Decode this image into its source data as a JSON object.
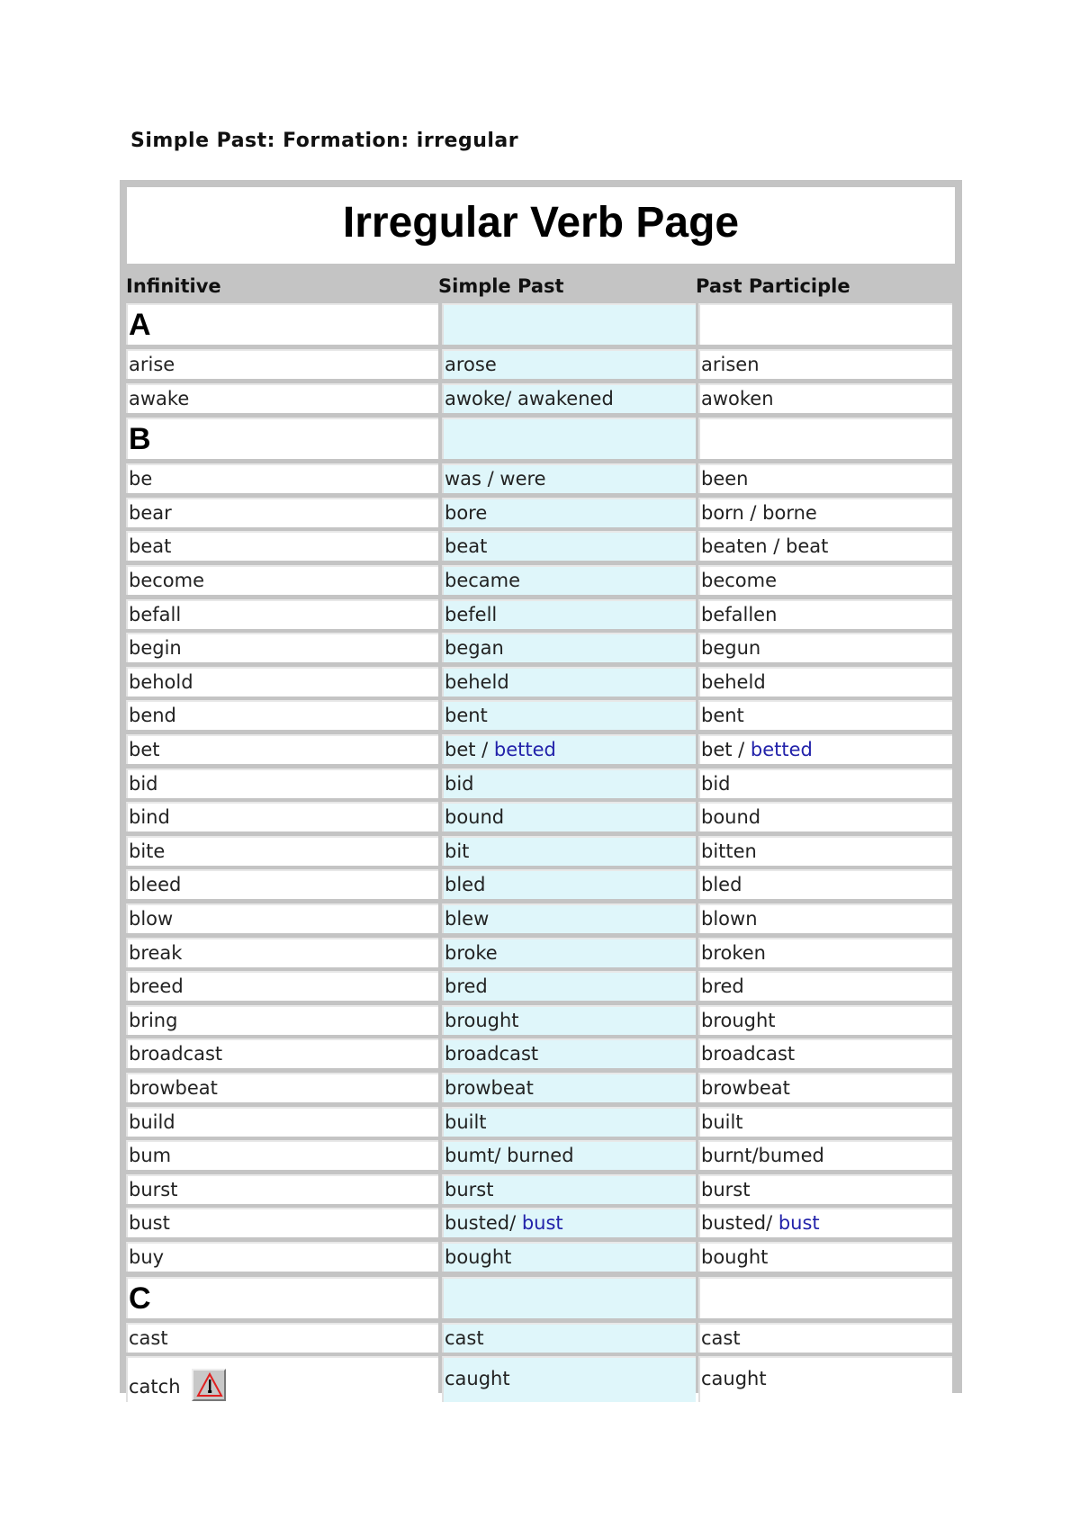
{
  "page_heading": "Simple Past: Formation: irregular",
  "table": {
    "title": "Irregular Verb Page",
    "columns": [
      "Infinitive",
      "Simple Past",
      "Past Participle"
    ],
    "highlight_color": "#dff6fa",
    "alt_form_color": "#2222aa",
    "sections": [
      {
        "letter": "A",
        "rows": [
          {
            "infinitive": "arise",
            "past": "arose",
            "past_alt": "",
            "participle": "arisen",
            "participle_alt": ""
          },
          {
            "infinitive": "awake",
            "past": "awoke/ awakened",
            "past_alt": "",
            "participle": "awoken",
            "participle_alt": ""
          }
        ]
      },
      {
        "letter": "B",
        "rows": [
          {
            "infinitive": "be",
            "past": "was / were",
            "past_alt": "",
            "participle": "been",
            "participle_alt": ""
          },
          {
            "infinitive": "bear",
            "past": "bore",
            "past_alt": "",
            "participle": "born / borne",
            "participle_alt": ""
          },
          {
            "infinitive": "beat",
            "past": "beat",
            "past_alt": "",
            "participle": "beaten / beat",
            "participle_alt": ""
          },
          {
            "infinitive": "become",
            "past": "became",
            "past_alt": "",
            "participle": "become",
            "participle_alt": ""
          },
          {
            "infinitive": "befall",
            "past": "befell",
            "past_alt": "",
            "participle": "befallen",
            "participle_alt": ""
          },
          {
            "infinitive": "begin",
            "past": "began",
            "past_alt": "",
            "participle": "begun",
            "participle_alt": ""
          },
          {
            "infinitive": "behold",
            "past": "beheld",
            "past_alt": "",
            "participle": "beheld",
            "participle_alt": ""
          },
          {
            "infinitive": "bend",
            "past": "bent",
            "past_alt": "",
            "participle": "bent",
            "participle_alt": ""
          },
          {
            "infinitive": "bet",
            "past": "bet / ",
            "past_alt": "betted",
            "participle": "bet / ",
            "participle_alt": "betted"
          },
          {
            "infinitive": "bid",
            "past": "bid",
            "past_alt": "",
            "participle": "bid",
            "participle_alt": ""
          },
          {
            "infinitive": "bind",
            "past": "bound",
            "past_alt": "",
            "participle": "bound",
            "participle_alt": ""
          },
          {
            "infinitive": "bite",
            "past": "bit",
            "past_alt": "",
            "participle": "bitten",
            "participle_alt": ""
          },
          {
            "infinitive": "bleed",
            "past": "bled",
            "past_alt": "",
            "participle": "bled",
            "participle_alt": ""
          },
          {
            "infinitive": "blow",
            "past": "blew",
            "past_alt": "",
            "participle": "blown",
            "participle_alt": ""
          },
          {
            "infinitive": "break",
            "past": "broke",
            "past_alt": "",
            "participle": "broken",
            "participle_alt": ""
          },
          {
            "infinitive": "breed",
            "past": "bred",
            "past_alt": "",
            "participle": "bred",
            "participle_alt": ""
          },
          {
            "infinitive": "bring",
            "past": "brought",
            "past_alt": "",
            "participle": "brought",
            "participle_alt": ""
          },
          {
            "infinitive": "broadcast",
            "past": "broadcast",
            "past_alt": "",
            "participle": "broadcast",
            "participle_alt": ""
          },
          {
            "infinitive": "browbeat",
            "past": "browbeat",
            "past_alt": "",
            "participle": "browbeat",
            "participle_alt": ""
          },
          {
            "infinitive": "build",
            "past": "built",
            "past_alt": "",
            "participle": "built",
            "participle_alt": ""
          },
          {
            "infinitive": "bum",
            "past": "bumt/ burned",
            "past_alt": "",
            "participle": "burnt/bumed",
            "participle_alt": ""
          },
          {
            "infinitive": "burst",
            "past": "burst",
            "past_alt": "",
            "participle": "burst",
            "participle_alt": ""
          },
          {
            "infinitive": "bust",
            "past": "busted/ ",
            "past_alt": "bust",
            "participle": "busted/ ",
            "participle_alt": "bust"
          },
          {
            "infinitive": "buy",
            "past": "bought",
            "past_alt": "",
            "participle": "bought",
            "participle_alt": ""
          }
        ]
      },
      {
        "letter": "C",
        "rows": [
          {
            "infinitive": "cast",
            "past": "cast",
            "past_alt": "",
            "participle": "cast",
            "participle_alt": ""
          },
          {
            "infinitive": "catch",
            "past": "caught",
            "past_alt": "",
            "participle": "caught",
            "participle_alt": "",
            "icon": "warning-triangle-icon"
          }
        ]
      }
    ]
  }
}
